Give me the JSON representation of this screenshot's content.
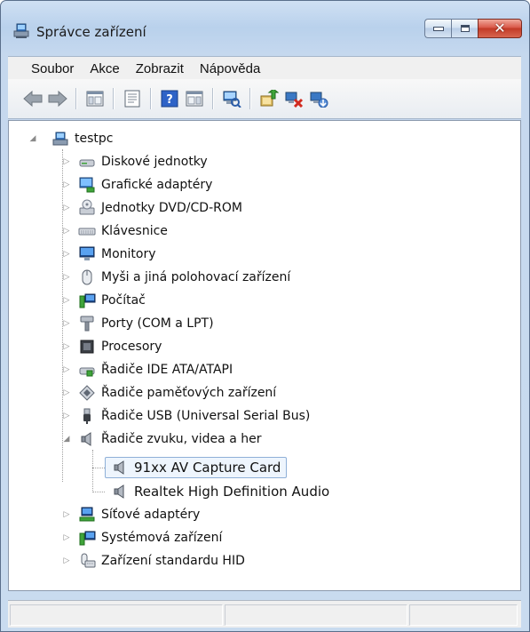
{
  "window": {
    "title": "Správce zařízení"
  },
  "menu": {
    "items": [
      "Soubor",
      "Akce",
      "Zobrazit",
      "Nápověda"
    ]
  },
  "tree": {
    "root": "testpc",
    "categories": [
      "Diskové jednotky",
      "Grafické adaptéry",
      "Jednotky DVD/CD-ROM",
      "Klávesnice",
      "Monitory",
      "Myši a jiná polohovací zařízení",
      "Počítač",
      "Porty (COM a LPT)",
      "Procesory",
      "Řadiče IDE ATA/ATAPI",
      "Řadiče paměťových zařízení",
      "Řadiče USB (Universal Serial Bus)",
      "Řadiče zvuku, videa a her",
      "Síťové adaptéry",
      "Systémová zařízení",
      "Zařízení standardu HID"
    ],
    "sound_children": [
      "91xx AV Capture Card",
      "Realtek High Definition Audio"
    ]
  }
}
